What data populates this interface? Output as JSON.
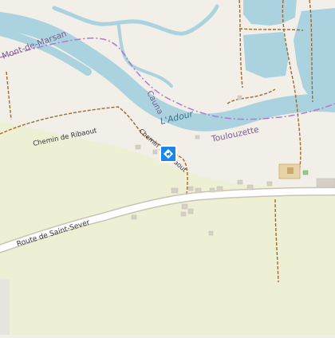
{
  "labels": {
    "mont_de_marsan": "Mont-de-Marsan",
    "cauna": "Cauna",
    "ladour": "L'Adour",
    "toulouzette": "Toulouzette",
    "chemin_ribaout": "Chemin de Ribaout",
    "chemin_ribaout_short": "Chemin de Ribaout",
    "route_saint_sever": "Route de Saint-Sever"
  },
  "colors": {
    "land": "#f2efe9",
    "fields": "#eef0d5",
    "water": "#aad3df",
    "river_text": "#3d6f8a",
    "place_text": "#7a5c90",
    "road_text": "#333333",
    "marker": "#1a86e8",
    "boundary": "#b07ad0",
    "track": "#a0692f"
  },
  "marker": {
    "icon": "diamond-signpost-icon"
  }
}
